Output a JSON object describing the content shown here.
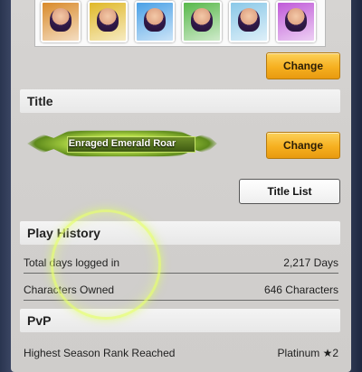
{
  "characters": {
    "cards": [
      {
        "icon": "character-portrait-icon",
        "color": "#d98a2a"
      },
      {
        "icon": "character-portrait-icon",
        "color": "#e0b828"
      },
      {
        "icon": "character-portrait-icon",
        "color": "#4aa0e6"
      },
      {
        "icon": "character-portrait-icon",
        "color": "#58b84a"
      },
      {
        "icon": "character-portrait-icon",
        "color": "#8ac8e8"
      },
      {
        "icon": "character-portrait-icon",
        "color": "#c05ad8"
      }
    ],
    "change_label": "Change"
  },
  "title_section": {
    "heading": "Title",
    "badge_text": "Enraged Emerald Roar",
    "change_label": "Change",
    "title_list_label": "Title List"
  },
  "play_history": {
    "heading": "Play History",
    "rows": [
      {
        "label": "Total days logged in",
        "value": "2,217 Days"
      },
      {
        "label": "Characters Owned",
        "value": "646 Characters"
      }
    ]
  },
  "pvp": {
    "heading": "PvP",
    "rows": [
      {
        "label": "Highest Season Rank Reached",
        "value": "Platinum ★2"
      }
    ]
  },
  "colors": {
    "accent_orange": "#f6b020",
    "badge_green": "#b9e14a"
  }
}
